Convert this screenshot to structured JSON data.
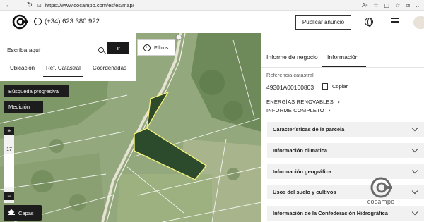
{
  "browser": {
    "url": "https://www.cocampo.com/es/es/map/"
  },
  "header": {
    "phone": "(+34) 623 380 922",
    "publish_label": "Publicar anuncio",
    "brand_color": "#1c1c1c",
    "logo_icon": "cocampo-logo-icon"
  },
  "map_controls": {
    "search_placeholder": "Escriba aquí",
    "go_label": "Ir",
    "tabs": [
      {
        "label": "Ubicación",
        "active": false
      },
      {
        "label": "Ref. Catastral",
        "active": true
      },
      {
        "label": "Coordenadas",
        "active": false
      }
    ],
    "filters_label": "Filtros",
    "progressive_search_label": "Búsqueda progresiva",
    "measure_label": "Medición",
    "zoom_in": "+",
    "zoom_level": "17",
    "zoom_out": "−",
    "layers_label": "Capas",
    "parcel_highlight_color": "#f4f27a"
  },
  "panel": {
    "tabs": [
      {
        "label": "Informe de negocio",
        "active": false
      },
      {
        "label": "Información",
        "active": true
      }
    ],
    "cadastral_ref_label": "Referencia catastral",
    "cadastral_ref_value": "49301A00100803",
    "copy_label": "Copiar",
    "links": [
      {
        "label": "ENERGÍAS RENOVABLES"
      },
      {
        "label": "INFORME COMPLETO"
      }
    ],
    "sections": [
      {
        "label": "Características de la parcela"
      },
      {
        "label": "Información climática"
      },
      {
        "label": "Información geográfica"
      },
      {
        "label": "Usos del suelo y cultivos"
      },
      {
        "label": "Información de la Confederación Hidrográfica"
      }
    ],
    "watermark_text": "cocampo"
  }
}
